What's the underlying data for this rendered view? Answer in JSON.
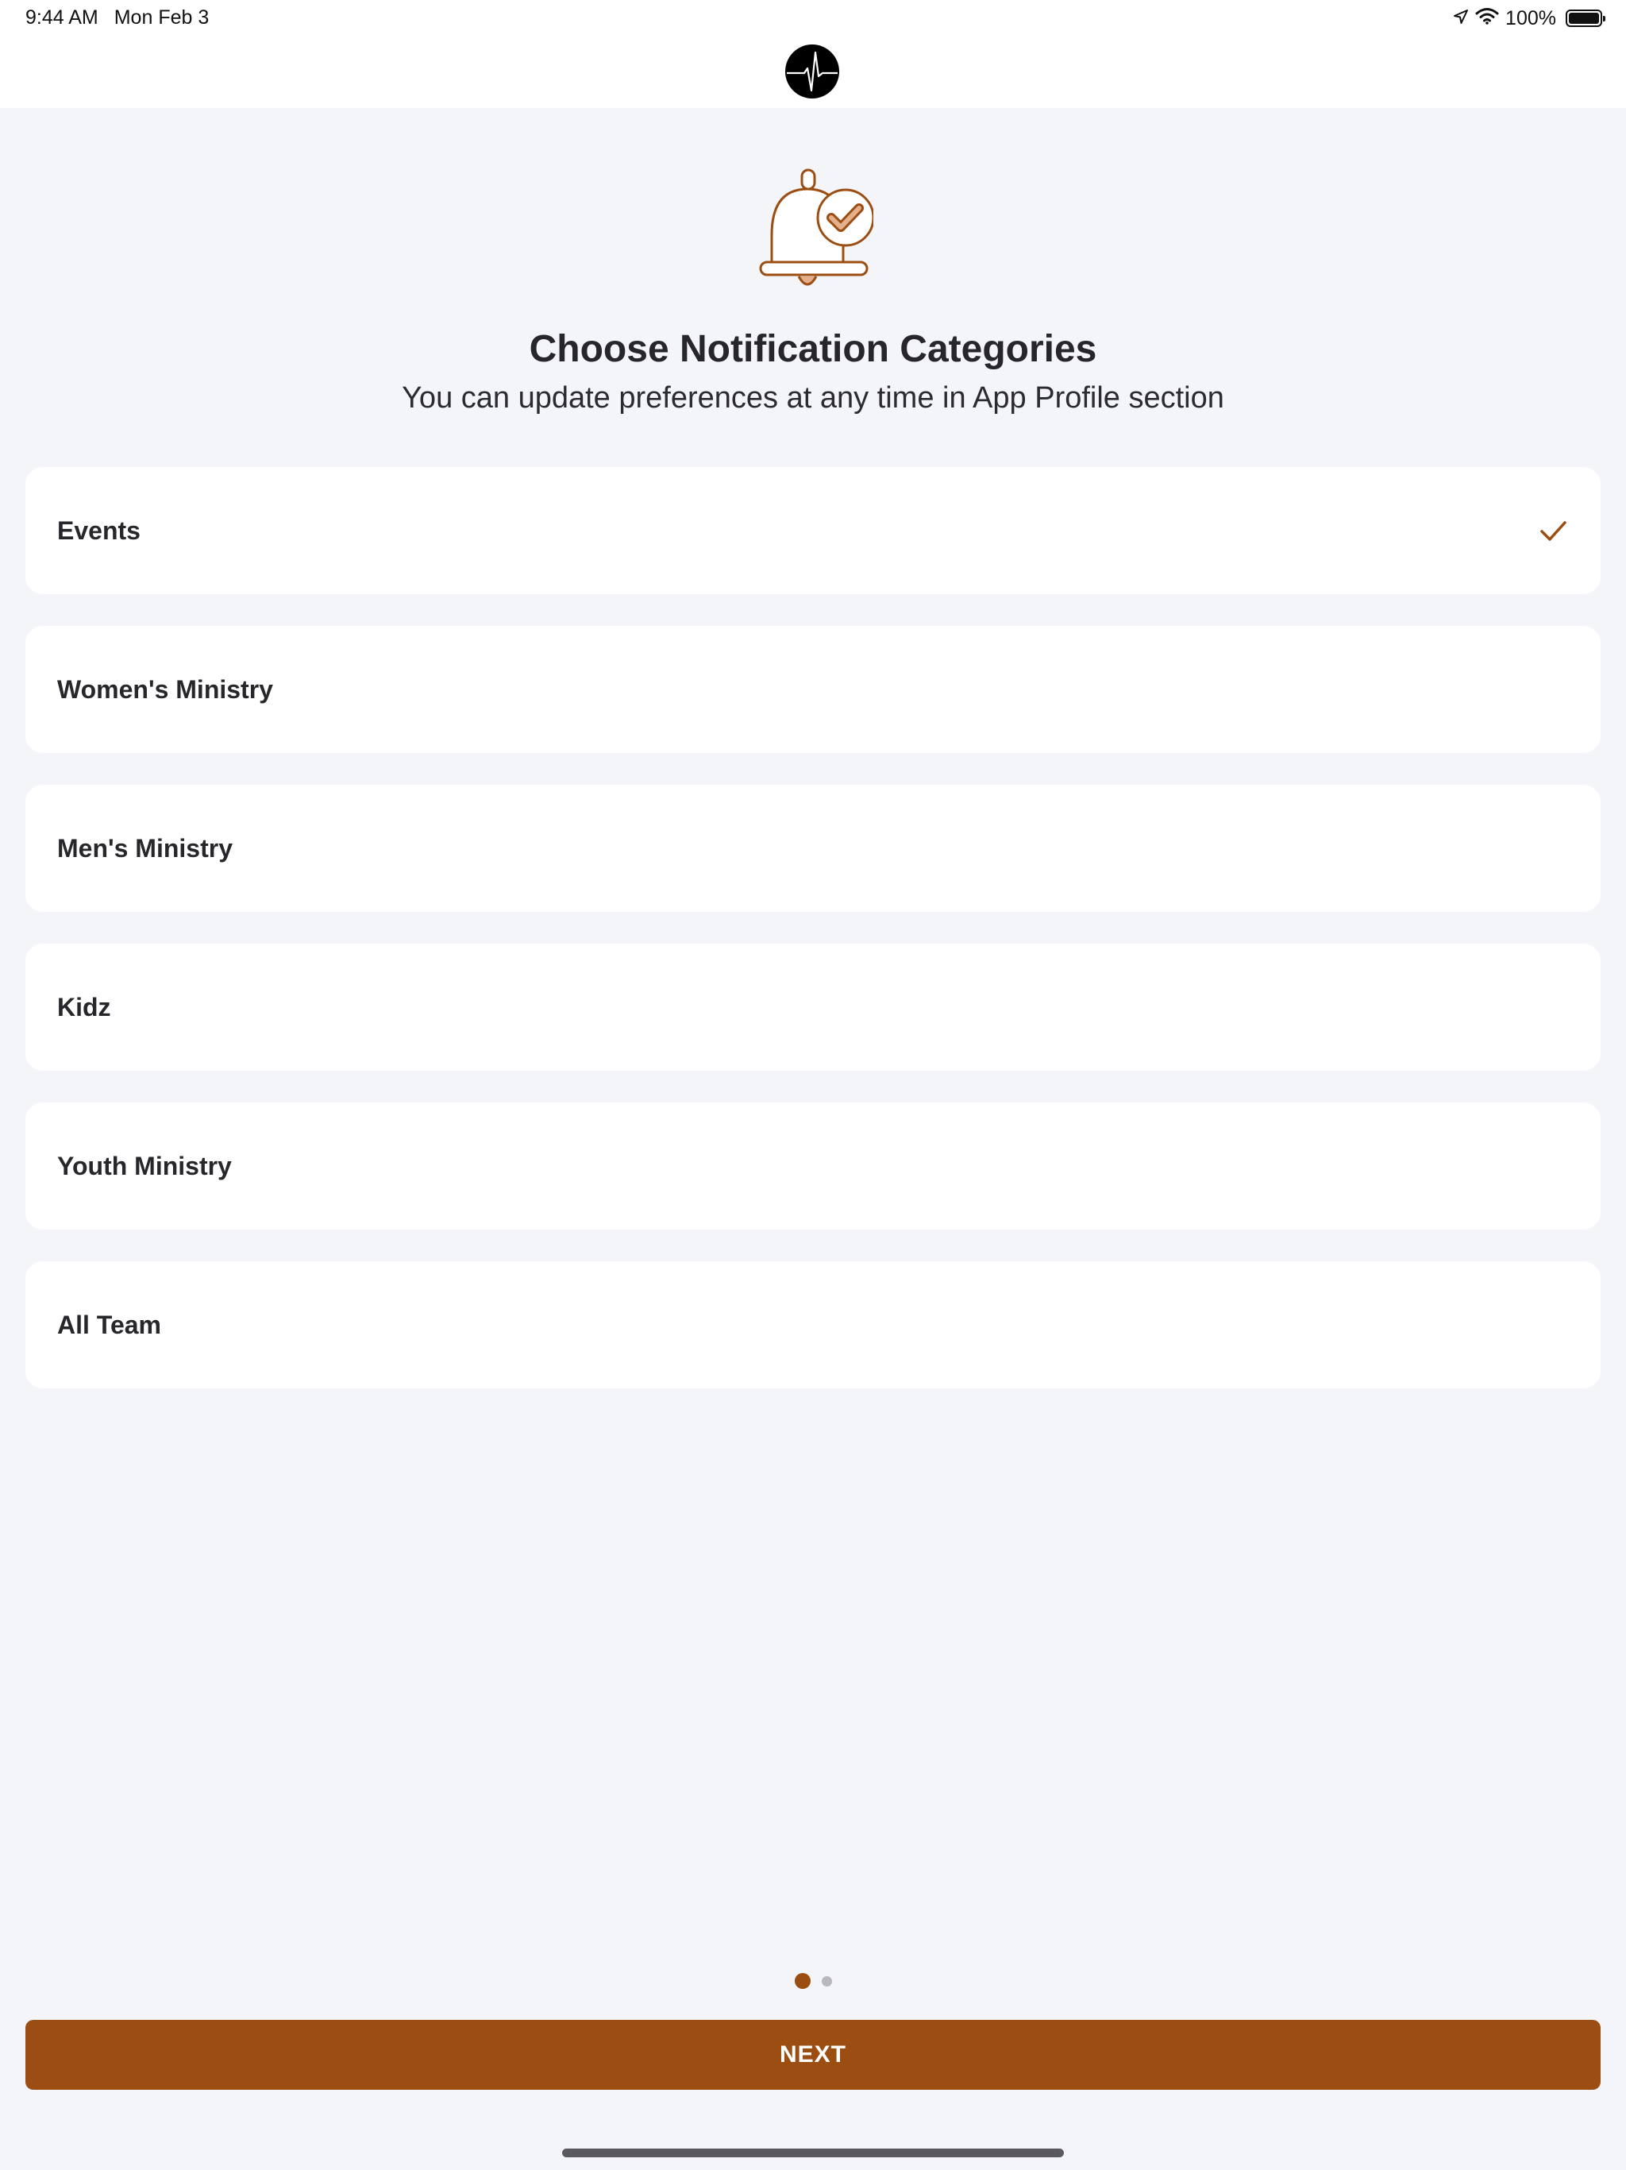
{
  "status_bar": {
    "time": "9:44 AM",
    "date": "Mon Feb 3",
    "battery": "100%",
    "icons": [
      "location-arrow-icon",
      "wifi-icon",
      "battery-icon"
    ]
  },
  "header": {
    "logo_icon": "heartbeat-logo-icon"
  },
  "onboarding": {
    "hero_icon": "bell-check-icon",
    "title": "Choose Notification Categories",
    "subtitle": "You can update preferences at any time in App Profile section"
  },
  "categories": [
    {
      "label": "Events",
      "selected": true
    },
    {
      "label": "Women's Ministry",
      "selected": false
    },
    {
      "label": "Men's Ministry",
      "selected": false
    },
    {
      "label": "Kidz",
      "selected": false
    },
    {
      "label": "Youth Ministry",
      "selected": false
    },
    {
      "label": "All Team",
      "selected": false
    }
  ],
  "pager": {
    "current_page": 1,
    "total_pages": 2
  },
  "footer": {
    "next_label": "NEXT"
  },
  "colors": {
    "accent": "#9c4e12",
    "background": "#f4f5f8",
    "card": "#ffffff",
    "text": "#26262b"
  }
}
